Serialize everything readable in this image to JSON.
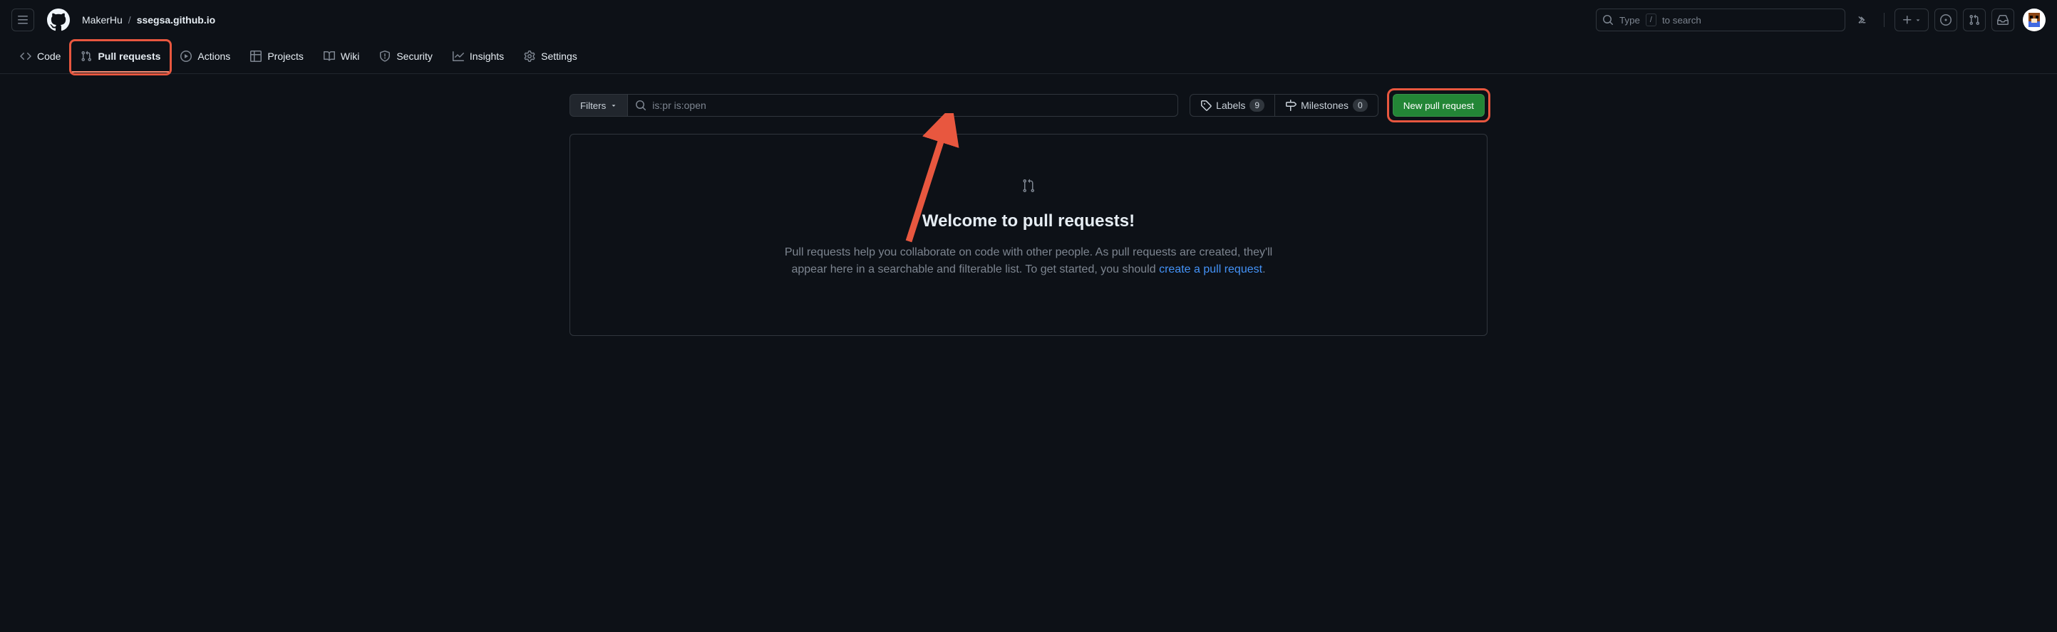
{
  "header": {
    "owner": "MakerHu",
    "sep": "/",
    "repo": "ssegsa.github.io",
    "search_prefix": "Type",
    "search_kbd": "/",
    "search_suffix": "to search"
  },
  "nav": {
    "code": "Code",
    "pull_requests": "Pull requests",
    "actions": "Actions",
    "projects": "Projects",
    "wiki": "Wiki",
    "security": "Security",
    "insights": "Insights",
    "settings": "Settings"
  },
  "toolbar": {
    "filters_label": "Filters",
    "filter_value": "is:pr is:open",
    "labels_label": "Labels",
    "labels_count": "9",
    "milestones_label": "Milestones",
    "milestones_count": "0",
    "new_pr_label": "New pull request"
  },
  "blank": {
    "title": "Welcome to pull requests!",
    "text_1": "Pull requests help you collaborate on code with other people. As pull requests are created, they'll appear here in a searchable and filterable list. To get started, you should ",
    "link": "create a pull request",
    "period": "."
  }
}
